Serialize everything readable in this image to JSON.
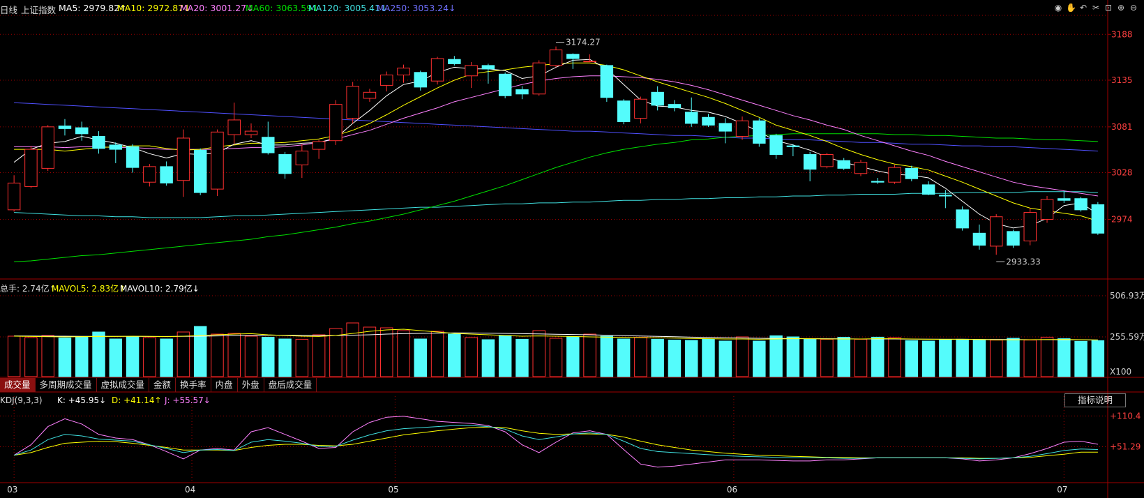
{
  "header": {
    "period": "日线",
    "name": "上证指数",
    "ma5": "MA5: 2979.82↑",
    "ma10": "MA10: 2972.87↓",
    "ma20": "MA20: 3001.27↓",
    "ma60": "MA60: 3063.59↓",
    "ma120": "MA120: 3005.41↓",
    "ma250": "MA250: 3053.24↓"
  },
  "toolbar_icons": [
    "eye-icon",
    "hand-icon",
    "undo-icon",
    "scissors-icon",
    "lock-icon",
    "zoom-in-icon",
    "zoom-out-icon"
  ],
  "volume_header": {
    "total": "总手: 2.74亿↑",
    "mavol5": "MAVOL5: 2.83亿↑",
    "mavol10": "MAVOL10: 2.79亿↓"
  },
  "tabs": [
    "成交量",
    "多周期成交量",
    "虚拟成交量",
    "金额",
    "换手率",
    "内盘",
    "外盘",
    "盘后成交量"
  ],
  "kdj_header": {
    "name": "KDJ(9,3,3)",
    "k": "K: +45.95↓",
    "d": "D: +41.14↑",
    "j": "J: +55.57↓"
  },
  "indicator_button": "指标说明",
  "colors": {
    "up": "#ff3030",
    "down": "#54fcfc",
    "ma5": "#ffffff",
    "ma10": "#ffff00",
    "ma20": "#ff80ff",
    "ma60": "#00e000",
    "ma120": "#40e0e0",
    "ma250": "#5050ff",
    "axis": "#a00000",
    "label": "#ff4040",
    "k": "#ffffff",
    "d": "#ffff00",
    "j": "#ff80ff"
  },
  "chart_data": {
    "type": "candlestick",
    "price_axis": {
      "ylim": [
        2905,
        3210
      ],
      "ticks": [
        "3188",
        "3135",
        "3081",
        "3028",
        "2974"
      ]
    },
    "volume_axis": {
      "ylim": [
        0,
        600
      ],
      "ticks": [
        "506.93万",
        "255.59万"
      ],
      "unit": "X100"
    },
    "kdj_axis": {
      "ylim": [
        -15,
        135
      ],
      "ticks": [
        "+110.4",
        "+51.29"
      ]
    },
    "month_labels": [
      {
        "label": "03",
        "index": 0
      },
      {
        "label": "04",
        "index": 10.5
      },
      {
        "label": "05",
        "index": 22.5
      },
      {
        "label": "06",
        "index": 42.5
      },
      {
        "label": "07",
        "index": 62
      }
    ],
    "annotations": [
      {
        "text": "3174.27",
        "index": 32
      },
      {
        "text": "2933.33",
        "index": 58
      }
    ],
    "candles": [
      {
        "o": 2985,
        "c": 3016,
        "h": 3025,
        "l": 2983
      },
      {
        "o": 3012,
        "c": 3055,
        "h": 3059,
        "l": 3010
      },
      {
        "o": 3033,
        "c": 3081,
        "h": 3083,
        "l": 3030
      },
      {
        "o": 3082,
        "c": 3079,
        "h": 3090,
        "l": 3071
      },
      {
        "o": 3080,
        "c": 3073,
        "h": 3087,
        "l": 3065
      },
      {
        "o": 3070,
        "c": 3056,
        "h": 3076,
        "l": 3050
      },
      {
        "o": 3060,
        "c": 3055,
        "h": 3063,
        "l": 3039
      },
      {
        "o": 3058,
        "c": 3034,
        "h": 3061,
        "l": 3028
      },
      {
        "o": 3017,
        "c": 3035,
        "h": 3038,
        "l": 3012
      },
      {
        "o": 3035,
        "c": 3016,
        "h": 3041,
        "l": 3013
      },
      {
        "o": 3019,
        "c": 3068,
        "h": 3078,
        "l": 3000
      },
      {
        "o": 3054,
        "c": 3005,
        "h": 3056,
        "l": 3002
      },
      {
        "o": 3009,
        "c": 3075,
        "h": 3078,
        "l": 3001
      },
      {
        "o": 3072,
        "c": 3089,
        "h": 3109,
        "l": 3061
      },
      {
        "o": 3072,
        "c": 3076,
        "h": 3085,
        "l": 3068
      },
      {
        "o": 3069,
        "c": 3051,
        "h": 3087,
        "l": 3049
      },
      {
        "o": 3049,
        "c": 3027,
        "h": 3052,
        "l": 3021
      },
      {
        "o": 3037,
        "c": 3053,
        "h": 3061,
        "l": 3022
      },
      {
        "o": 3055,
        "c": 3064,
        "h": 3066,
        "l": 3044
      },
      {
        "o": 3065,
        "c": 3107,
        "h": 3112,
        "l": 3060
      },
      {
        "o": 3091,
        "c": 3128,
        "h": 3133,
        "l": 3085
      },
      {
        "o": 3114,
        "c": 3121,
        "h": 3125,
        "l": 3110
      },
      {
        "o": 3129,
        "c": 3141,
        "h": 3145,
        "l": 3122
      },
      {
        "o": 3141,
        "c": 3149,
        "h": 3153,
        "l": 3132
      },
      {
        "o": 3144,
        "c": 3127,
        "h": 3146,
        "l": 3123
      },
      {
        "o": 3134,
        "c": 3160,
        "h": 3162,
        "l": 3130
      },
      {
        "o": 3159,
        "c": 3154,
        "h": 3163,
        "l": 3152
      },
      {
        "o": 3140,
        "c": 3152,
        "h": 3156,
        "l": 3126
      },
      {
        "o": 3152,
        "c": 3148,
        "h": 3154,
        "l": 3131
      },
      {
        "o": 3142,
        "c": 3117,
        "h": 3144,
        "l": 3114
      },
      {
        "o": 3124,
        "c": 3119,
        "h": 3128,
        "l": 3113
      },
      {
        "o": 3119,
        "c": 3155,
        "h": 3158,
        "l": 3117
      },
      {
        "o": 3152,
        "c": 3170,
        "h": 3174,
        "l": 3150
      },
      {
        "o": 3165,
        "c": 3160,
        "h": 3166,
        "l": 3148
      },
      {
        "o": 3157,
        "c": 3157,
        "h": 3165,
        "l": 3157
      },
      {
        "o": 3152,
        "c": 3115,
        "h": 3153,
        "l": 3110
      },
      {
        "o": 3111,
        "c": 3087,
        "h": 3113,
        "l": 3084
      },
      {
        "o": 3091,
        "c": 3113,
        "h": 3116,
        "l": 3085
      },
      {
        "o": 3121,
        "c": 3106,
        "h": 3128,
        "l": 3100
      },
      {
        "o": 3107,
        "c": 3103,
        "h": 3112,
        "l": 3099
      },
      {
        "o": 3098,
        "c": 3085,
        "h": 3115,
        "l": 3081
      },
      {
        "o": 3092,
        "c": 3083,
        "h": 3096,
        "l": 3081
      },
      {
        "o": 3085,
        "c": 3076,
        "h": 3091,
        "l": 3062
      },
      {
        "o": 3070,
        "c": 3088,
        "h": 3093,
        "l": 3066
      },
      {
        "o": 3088,
        "c": 3062,
        "h": 3091,
        "l": 3058
      },
      {
        "o": 3071,
        "c": 3049,
        "h": 3073,
        "l": 3044
      },
      {
        "o": 3059,
        "c": 3058,
        "h": 3061,
        "l": 3047
      },
      {
        "o": 3049,
        "c": 3032,
        "h": 3052,
        "l": 3018
      },
      {
        "o": 3035,
        "c": 3049,
        "h": 3051,
        "l": 3033
      },
      {
        "o": 3042,
        "c": 3033,
        "h": 3045,
        "l": 3031
      },
      {
        "o": 3027,
        "c": 3040,
        "h": 3043,
        "l": 3024
      },
      {
        "o": 3018,
        "c": 3017,
        "h": 3022,
        "l": 3015
      },
      {
        "o": 3017,
        "c": 3034,
        "h": 3037,
        "l": 3015
      },
      {
        "o": 3033,
        "c": 3021,
        "h": 3036,
        "l": 3018
      },
      {
        "o": 3014,
        "c": 3003,
        "h": 3018,
        "l": 3002
      },
      {
        "o": 3002,
        "c": 3001,
        "h": 3008,
        "l": 2987
      },
      {
        "o": 2985,
        "c": 2964,
        "h": 2989,
        "l": 2961
      },
      {
        "o": 2958,
        "c": 2944,
        "h": 2968,
        "l": 2939
      },
      {
        "o": 2943,
        "c": 2977,
        "h": 2980,
        "l": 2933
      },
      {
        "o": 2960,
        "c": 2944,
        "h": 2962,
        "l": 2941
      },
      {
        "o": 2949,
        "c": 2982,
        "h": 2987,
        "l": 2944
      },
      {
        "o": 2974,
        "c": 2997,
        "h": 3001,
        "l": 2970
      },
      {
        "o": 2998,
        "c": 2996,
        "h": 3007,
        "l": 2993
      },
      {
        "o": 2998,
        "c": 2985,
        "h": 3000,
        "l": 2983
      },
      {
        "o": 2991,
        "c": 2958,
        "h": 2994,
        "l": 2956
      }
    ],
    "ma5": [
      3040,
      3055,
      3062,
      3064,
      3070,
      3066,
      3062,
      3057,
      3050,
      3045,
      3050,
      3049,
      3051,
      3061,
      3065,
      3060,
      3060,
      3062,
      3063,
      3068,
      3085,
      3100,
      3117,
      3130,
      3134,
      3144,
      3150,
      3148,
      3148,
      3146,
      3137,
      3140,
      3150,
      3158,
      3159,
      3148,
      3130,
      3112,
      3105,
      3104,
      3100,
      3098,
      3093,
      3085,
      3075,
      3065,
      3060,
      3054,
      3046,
      3040,
      3035,
      3030,
      3026,
      3025,
      3022,
      3010,
      2995,
      2980,
      2969,
      2964,
      2967,
      2975,
      2990,
      2993,
      2980
    ],
    "ma10": [
      3055,
      3055,
      3055,
      3053,
      3055,
      3057,
      3058,
      3059,
      3059,
      3056,
      3054,
      3055,
      3058,
      3060,
      3062,
      3062,
      3063,
      3065,
      3067,
      3071,
      3077,
      3085,
      3095,
      3106,
      3116,
      3126,
      3135,
      3142,
      3145,
      3147,
      3150,
      3152,
      3154,
      3155,
      3155,
      3152,
      3147,
      3140,
      3133,
      3127,
      3121,
      3115,
      3108,
      3100,
      3092,
      3083,
      3077,
      3071,
      3064,
      3056,
      3049,
      3043,
      3038,
      3035,
      3031,
      3024,
      3017,
      3009,
      3001,
      2993,
      2987,
      2984,
      2981,
      2978,
      2972
    ],
    "ma20": [
      3058,
      3058,
      3058,
      3057,
      3058,
      3058,
      3057,
      3057,
      3056,
      3055,
      3055,
      3055,
      3055,
      3056,
      3057,
      3057,
      3058,
      3060,
      3063,
      3067,
      3072,
      3077,
      3084,
      3091,
      3097,
      3103,
      3110,
      3115,
      3120,
      3125,
      3130,
      3134,
      3137,
      3139,
      3140,
      3140,
      3139,
      3138,
      3136,
      3133,
      3129,
      3124,
      3118,
      3112,
      3106,
      3100,
      3094,
      3089,
      3083,
      3078,
      3071,
      3065,
      3059,
      3053,
      3048,
      3041,
      3035,
      3029,
      3023,
      3017,
      3013,
      3010,
      3007,
      3004,
      3001
    ],
    "ma60": [
      2925,
      2926,
      2928,
      2930,
      2932,
      2933,
      2935,
      2937,
      2939,
      2941,
      2943,
      2945,
      2947,
      2949,
      2951,
      2954,
      2956,
      2959,
      2962,
      2965,
      2969,
      2972,
      2976,
      2980,
      2985,
      2990,
      2995,
      3001,
      3007,
      3013,
      3020,
      3027,
      3034,
      3040,
      3046,
      3051,
      3055,
      3058,
      3061,
      3063,
      3066,
      3067,
      3069,
      3070,
      3071,
      3072,
      3073,
      3073,
      3073,
      3073,
      3073,
      3073,
      3072,
      3072,
      3071,
      3071,
      3070,
      3069,
      3068,
      3068,
      3067,
      3066,
      3066,
      3065,
      3064
    ],
    "ma120": [
      2982,
      2981,
      2980,
      2979,
      2978,
      2978,
      2977,
      2977,
      2976,
      2976,
      2976,
      2976,
      2977,
      2978,
      2978,
      2979,
      2980,
      2981,
      2982,
      2983,
      2984,
      2985,
      2986,
      2987,
      2988,
      2988,
      2989,
      2990,
      2991,
      2992,
      2992,
      2993,
      2993,
      2994,
      2994,
      2995,
      2996,
      2996,
      2997,
      2997,
      2998,
      2998,
      2999,
      2999,
      3000,
      3000,
      3001,
      3001,
      3002,
      3002,
      3003,
      3003,
      3003,
      3004,
      3004,
      3004,
      3005,
      3005,
      3005,
      3005,
      3006,
      3006,
      3006,
      3006,
      3005
    ],
    "ma250": [
      3109,
      3108,
      3107,
      3106,
      3105,
      3104,
      3103,
      3102,
      3101,
      3100,
      3099,
      3098,
      3097,
      3096,
      3095,
      3094,
      3093,
      3092,
      3091,
      3090,
      3089,
      3088,
      3087,
      3086,
      3085,
      3084,
      3083,
      3082,
      3081,
      3080,
      3079,
      3078,
      3077,
      3076,
      3076,
      3075,
      3074,
      3073,
      3072,
      3071,
      3071,
      3070,
      3069,
      3068,
      3068,
      3067,
      3066,
      3066,
      3065,
      3064,
      3063,
      3063,
      3062,
      3061,
      3061,
      3060,
      3059,
      3059,
      3058,
      3058,
      3057,
      3056,
      3055,
      3054,
      3053
    ],
    "volume": [
      290,
      280,
      295,
      278,
      288,
      320,
      270,
      285,
      280,
      270,
      320,
      360,
      305,
      310,
      290,
      282,
      270,
      268,
      300,
      345,
      385,
      355,
      350,
      330,
      270,
      325,
      305,
      280,
      265,
      295,
      268,
      330,
      275,
      285,
      305,
      290,
      270,
      282,
      268,
      262,
      260,
      270,
      255,
      285,
      255,
      293,
      285,
      270,
      268,
      282,
      268,
      283,
      280,
      258,
      255,
      265,
      268,
      262,
      262,
      275,
      262,
      283,
      272,
      253,
      258
    ],
    "mavol5": [
      290,
      288,
      286,
      285,
      286,
      289,
      288,
      290,
      289,
      287,
      290,
      295,
      300,
      305,
      308,
      300,
      295,
      290,
      288,
      295,
      310,
      325,
      335,
      340,
      330,
      320,
      310,
      305,
      300,
      295,
      290,
      292,
      290,
      288,
      285,
      283,
      282,
      280,
      278,
      276,
      274,
      272,
      270,
      270,
      268,
      270,
      272,
      272,
      270,
      270,
      270,
      272,
      272,
      270,
      268,
      268,
      268,
      266,
      264,
      264,
      265,
      266,
      266,
      265,
      263
    ],
    "mavol10": [
      292,
      291,
      290,
      290,
      289,
      289,
      289,
      289,
      288,
      288,
      289,
      290,
      292,
      294,
      296,
      297,
      297,
      296,
      295,
      295,
      297,
      300,
      305,
      308,
      310,
      312,
      314,
      313,
      312,
      310,
      308,
      306,
      304,
      302,
      300,
      297,
      294,
      291,
      289,
      286,
      283,
      281,
      279,
      277,
      275,
      274,
      273,
      272,
      272,
      271,
      270,
      270,
      270,
      269,
      269,
      268,
      268,
      267,
      266,
      266,
      265,
      265,
      264,
      264,
      263
    ],
    "kdj_k": [
      35,
      45,
      65,
      75,
      72,
      66,
      64,
      62,
      55,
      48,
      40,
      45,
      46,
      44,
      60,
      65,
      62,
      58,
      52,
      52,
      64,
      74,
      82,
      86,
      88,
      90,
      92,
      92,
      90,
      85,
      72,
      65,
      70,
      76,
      78,
      75,
      62,
      48,
      42,
      40,
      38,
      36,
      34,
      33,
      32,
      31,
      30,
      30,
      30,
      29,
      29,
      30,
      30,
      30,
      30,
      30,
      29,
      28,
      29,
      30,
      33,
      38,
      44,
      47,
      46
    ],
    "kdj_d": [
      35,
      40,
      50,
      58,
      60,
      62,
      61,
      58,
      54,
      50,
      45,
      45,
      45,
      44,
      50,
      54,
      56,
      56,
      54,
      53,
      56,
      62,
      68,
      74,
      78,
      82,
      85,
      88,
      89,
      88,
      82,
      77,
      75,
      76,
      76,
      75,
      70,
      62,
      55,
      50,
      45,
      42,
      39,
      37,
      35,
      34,
      33,
      32,
      31,
      31,
      30,
      30,
      30,
      30,
      30,
      30,
      30,
      29,
      29,
      30,
      31,
      34,
      37,
      41,
      41
    ],
    "kdj_j": [
      35,
      55,
      90,
      105,
      95,
      75,
      68,
      65,
      55,
      42,
      28,
      45,
      48,
      45,
      80,
      88,
      75,
      62,
      48,
      50,
      80,
      98,
      108,
      110,
      105,
      100,
      98,
      96,
      92,
      80,
      55,
      40,
      60,
      78,
      82,
      75,
      46,
      18,
      12,
      14,
      18,
      22,
      26,
      26,
      26,
      25,
      24,
      24,
      26,
      26,
      28,
      30,
      30,
      30,
      30,
      30,
      28,
      24,
      26,
      30,
      38,
      48,
      60,
      62,
      56
    ]
  }
}
